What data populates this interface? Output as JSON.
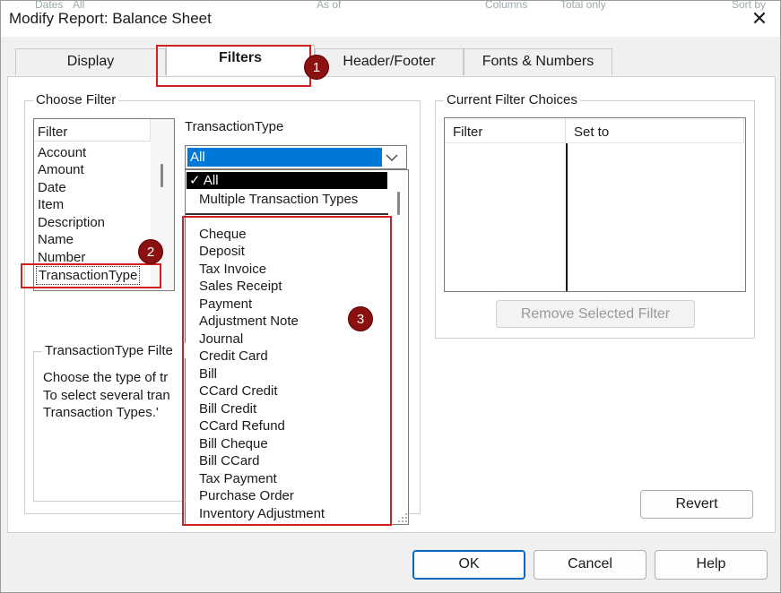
{
  "window": {
    "title": "Modify Report: Balance Sheet",
    "close_glyph": "✕"
  },
  "background_window": {
    "fragments": [
      "Dates",
      "All",
      "As of",
      "Columns",
      "Total only",
      "Sort by"
    ]
  },
  "tabs": [
    {
      "label": "Display"
    },
    {
      "label": "Filters"
    },
    {
      "label": "Header/Footer"
    },
    {
      "label": "Fonts & Numbers"
    }
  ],
  "choose_filter": {
    "group_label": "Choose Filter",
    "list_header": "Filter",
    "items": [
      "Account",
      "Amount",
      "Date",
      "Item",
      "Description",
      "Name",
      "Number",
      "TransactionType"
    ],
    "selected": "TransactionType"
  },
  "transaction_type": {
    "label": "TransactionType",
    "selected_value": "All",
    "dropdown_top": [
      {
        "check": "✓",
        "label": "All"
      },
      {
        "check": "",
        "label": "Multiple Transaction Types"
      }
    ],
    "dropdown_items": [
      "Cheque",
      "Deposit",
      "Tax Invoice",
      "Sales Receipt",
      "Payment",
      "Adjustment Note",
      "Journal",
      "Credit Card",
      "Bill",
      "CCard Credit",
      "Bill Credit",
      "CCard Refund",
      "Bill Cheque",
      "Bill CCard",
      "Tax Payment",
      "Purchase Order",
      "Inventory Adjustment"
    ]
  },
  "filter_help": {
    "group_label": "TransactionType Filte",
    "lines": [
      "Choose the type of tr",
      "To select several tran",
      "Transaction Types.'"
    ]
  },
  "current_choices": {
    "group_label": "Current Filter Choices",
    "col_filter": "Filter",
    "col_set_to": "Set to",
    "remove_button": "Remove Selected Filter"
  },
  "buttons": {
    "revert": "Revert",
    "ok": "OK",
    "cancel": "Cancel",
    "help": "Help"
  },
  "annotations": {
    "badge1": "1",
    "badge2": "2",
    "badge3": "3"
  },
  "colors": {
    "annotation_red": "#d02020",
    "badge_fill": "#8b1010",
    "selection_blue": "#0078d7"
  }
}
